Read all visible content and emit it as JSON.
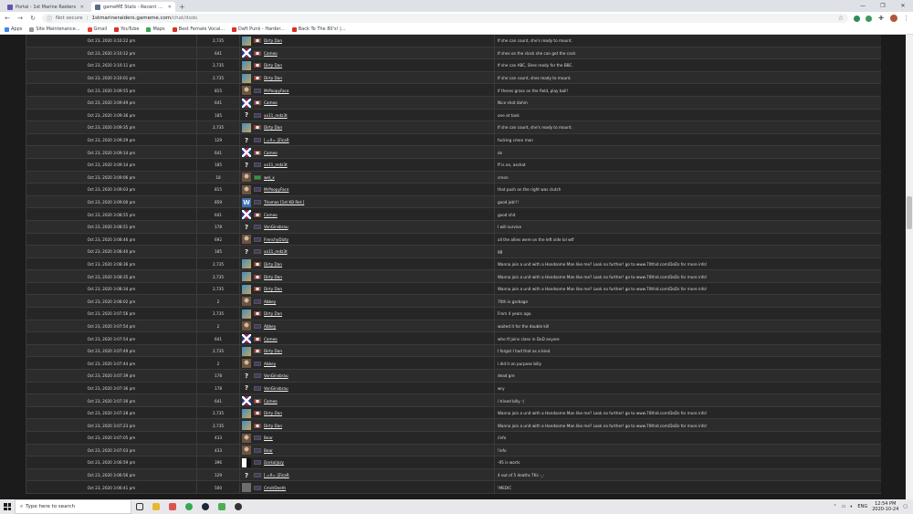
{
  "browser": {
    "tabs": [
      {
        "label": "Portal - 1st Marine Raiders",
        "active": false
      },
      {
        "label": "gameME Stats - Recent Chat Log",
        "active": true
      }
    ],
    "new_tab_icon": "+",
    "not_secure": "Not secure",
    "url_host": "1stmarineraiders.gameme.com",
    "url_path": "/chat/dods",
    "bookmarks": [
      {
        "label": "Apps",
        "icon": "grid"
      },
      {
        "label": "Site Maintenance...",
        "icon": "page"
      },
      {
        "label": "Gmail",
        "icon": "gm"
      },
      {
        "label": "YouTube",
        "icon": "red"
      },
      {
        "label": "Maps",
        "icon": "map"
      },
      {
        "label": "Best Female Vocal...",
        "icon": "red"
      },
      {
        "label": "Daft Punk - Harder...",
        "icon": "red"
      },
      {
        "label": "Back To The 80's! |...",
        "icon": "red"
      }
    ]
  },
  "chat_log": {
    "rows": [
      {
        "time": "Oct 23, 2020 3:10:22 pm",
        "id": "2,735",
        "avatar": "map",
        "flag": "ca",
        "player": "Dirty Dan",
        "msg": "If she can count, she's ready to mount."
      },
      {
        "time": "Oct 23, 2020 3:10:12 pm",
        "id": "641",
        "avatar": "uk",
        "flag": "ca",
        "player": "Cameo",
        "msg": "If shes on the clock she can get the cock"
      },
      {
        "time": "Oct 23, 2020 3:10:11 pm",
        "id": "2,735",
        "avatar": "map",
        "flag": "ca",
        "player": "Dirty Dan",
        "msg": "If she can ABC, Shes ready for the BBC."
      },
      {
        "time": "Oct 23, 2020 3:10:01 pm",
        "id": "2,735",
        "avatar": "map",
        "flag": "ca",
        "player": "Dirty Dan",
        "msg": "If she can count, shes ready to mount."
      },
      {
        "time": "Oct 23, 2020 3:09:55 pm",
        "id": "815",
        "avatar": "person",
        "flag": "us",
        "player": "MrPoopyFace",
        "msg": "if theres grass on the field, play ball!"
      },
      {
        "time": "Oct 23, 2020 3:09:49 pm",
        "id": "641",
        "avatar": "uk",
        "flag": "ca",
        "player": "Cameo",
        "msg": "Nice shot dahm"
      },
      {
        "time": "Oct 23, 2020 3:09:36 pm",
        "id": "185",
        "avatar": "unknown",
        "flag": "us",
        "player": "xx11_mdz3t",
        "msg": "one at taxk"
      },
      {
        "time": "Oct 23, 2020 3:09:35 pm",
        "id": "2,735",
        "avatar": "map",
        "flag": "ca",
        "player": "Dirty Dan",
        "msg": "If she can count, she's ready to mount."
      },
      {
        "time": "Oct 23, 2020 3:09:29 pm",
        "id": "129",
        "avatar": "unknown",
        "flag": "us",
        "player": "[.=X=.]ZicaR",
        "msg": "fucking cmon man"
      },
      {
        "time": "Oct 23, 2020 3:09:14 pm",
        "id": "641",
        "avatar": "uk",
        "flag": "ca",
        "player": "Cameo",
        "msg": "dx"
      },
      {
        "time": "Oct 23, 2020 3:09:14 pm",
        "id": "185",
        "avatar": "unknown",
        "flag": "us",
        "player": "xx11_mdz3t",
        "msg": "ff is on, asshat"
      },
      {
        "time": "Oct 23, 2020 3:09:06 pm",
        "id": "18",
        "avatar": "person",
        "flag": "green",
        "player": "wel_x",
        "msg": "cmon"
      },
      {
        "time": "Oct 23, 2020 3:09:03 pm",
        "id": "815",
        "avatar": "person",
        "flag": "us",
        "player": "MrPoopyFace",
        "msg": "that push on the right was clutch"
      },
      {
        "time": "Oct 23, 2020 3:09:00 pm",
        "id": "859",
        "avatar": "w",
        "flag": "us",
        "player": "Thomas [1st KB Ret.]",
        "msg": "good job!!!"
      },
      {
        "time": "Oct 23, 2020 3:08:55 pm",
        "id": "641",
        "avatar": "uk",
        "flag": "ca",
        "player": "Cameo",
        "msg": "good shit"
      },
      {
        "time": "Oct 23, 2020 3:08:51 pm",
        "id": "178",
        "avatar": "unknown",
        "flag": "us",
        "player": "VonGinsbrau",
        "msg": "I will survive"
      },
      {
        "time": "Oct 23, 2020 3:08:46 pm",
        "id": "692",
        "avatar": "person",
        "flag": "us",
        "player": "FrenchyDizty",
        "msg": "all the allies were on the left side lol wtf"
      },
      {
        "time": "Oct 23, 2020 3:08:40 pm",
        "id": "185",
        "avatar": "unknown",
        "flag": "us",
        "player": "xx11_mdz3t",
        "msg": "gg"
      },
      {
        "time": "Oct 23, 2020 3:08:36 pm",
        "id": "2,735",
        "avatar": "map",
        "flag": "ca",
        "player": "Dirty Dan",
        "msg": "Wanna join a unit with a Handsome Man like me? Look no further! go to www.70thid.com/DoDs for more info!"
      },
      {
        "time": "Oct 23, 2020 3:08:35 pm",
        "id": "2,735",
        "avatar": "map",
        "flag": "ca",
        "player": "Dirty Dan",
        "msg": "Wanna join a unit with a Handsome Man like me? Look no further! go to www.70thid.com/DoDs for more info!"
      },
      {
        "time": "Oct 23, 2020 3:08:34 pm",
        "id": "2,735",
        "avatar": "map",
        "flag": "ca",
        "player": "Dirty Dan",
        "msg": "Wanna join a unit with a Handsome Man like me? Look no further! go to www.70thid.com/DoDs for more info!"
      },
      {
        "time": "Oct 23, 2020 3:08:02 pm",
        "id": "2",
        "avatar": "person",
        "flag": "us",
        "player": "Abbey",
        "msg": "70th is garbage"
      },
      {
        "time": "Oct 23, 2020 3:07:56 pm",
        "id": "2,735",
        "avatar": "map",
        "flag": "ca",
        "player": "Dirty Dan",
        "msg": "From 4 years ago."
      },
      {
        "time": "Oct 23, 2020 3:07:54 pm",
        "id": "2",
        "avatar": "person",
        "flag": "us",
        "player": "Abbey",
        "msg": "waited it for the double kill"
      },
      {
        "time": "Oct 23, 2020 3:07:54 pm",
        "id": "641",
        "avatar": "uk",
        "flag": "ca",
        "player": "Cameo",
        "msg": "who tf joins clans in DoD anyore"
      },
      {
        "time": "Oct 23, 2020 3:07:49 pm",
        "id": "2,735",
        "avatar": "map",
        "flag": "ca",
        "player": "Dirty Dan",
        "msg": "I forgot I had that as a bind."
      },
      {
        "time": "Oct 23, 2020 3:07:44 pm",
        "id": "2",
        "avatar": "person",
        "flag": "us",
        "player": "Abbey",
        "msg": "i did it on purpose billy"
      },
      {
        "time": "Oct 23, 2020 3:07:39 pm",
        "id": "178",
        "avatar": "unknown",
        "flag": "us",
        "player": "VonGinsbrau",
        "msg": "dead gre"
      },
      {
        "time": "Oct 23, 2020 3:07:36 pm",
        "id": "178",
        "avatar": "unknown",
        "flag": "us",
        "player": "VonGinsbrau",
        "msg": "wry"
      },
      {
        "time": "Oct 23, 2020 3:07:30 pm",
        "id": "641",
        "avatar": "uk",
        "flag": "ca",
        "player": "Cameo",
        "msg": "i trieed billy :("
      },
      {
        "time": "Oct 23, 2020 3:07:28 pm",
        "id": "2,735",
        "avatar": "map",
        "flag": "ca",
        "player": "Dirty Dan",
        "msg": "Wanna join a unit with a Handsome Man like me? Look no further! go to www.70thid.com/DoDs for more info!"
      },
      {
        "time": "Oct 23, 2020 3:07:23 pm",
        "id": "2,735",
        "avatar": "map",
        "flag": "ca",
        "player": "Dirty Dan",
        "msg": "Wanna join a unit with a Handsome Man like me? Look no further! go to www.70thid.com/DoDs for more info!"
      },
      {
        "time": "Oct 23, 2020 3:07:05 pm",
        "id": "433",
        "avatar": "person",
        "flag": "us",
        "player": "Bear",
        "msg": "/info"
      },
      {
        "time": "Oct 23, 2020 3:07:03 pm",
        "id": "433",
        "avatar": "person",
        "flag": "us",
        "player": "Bear",
        "msg": "!info"
      },
      {
        "time": "Oct 23, 2020 3:06:59 pm",
        "id": "396",
        "avatar": "bw",
        "flag": "us",
        "player": "Darkaljazy",
        "msg": "-95 is worts"
      },
      {
        "time": "Oct 23, 2020 3:06:56 pm",
        "id": "129",
        "avatar": "unknown",
        "flag": "us",
        "player": "[.=X=.]ZicaR",
        "msg": "4 out of 5 deaths TKs -_-"
      },
      {
        "time": "Oct 23, 2020 3:06:41 pm",
        "id": "500",
        "avatar": "gun",
        "flag": "us",
        "player": "CmdrDeeth",
        "msg": "!MEDIC"
      }
    ]
  },
  "taskbar": {
    "search_placeholder": "Type here to search",
    "lang": "ENG",
    "time": "12:54 PM",
    "date": "2020-10-24"
  },
  "colors": {
    "page_bg": "#1b1b1b",
    "row_odd": "#262626",
    "row_even": "#2c2c2c",
    "text": "#dcdcdc"
  }
}
